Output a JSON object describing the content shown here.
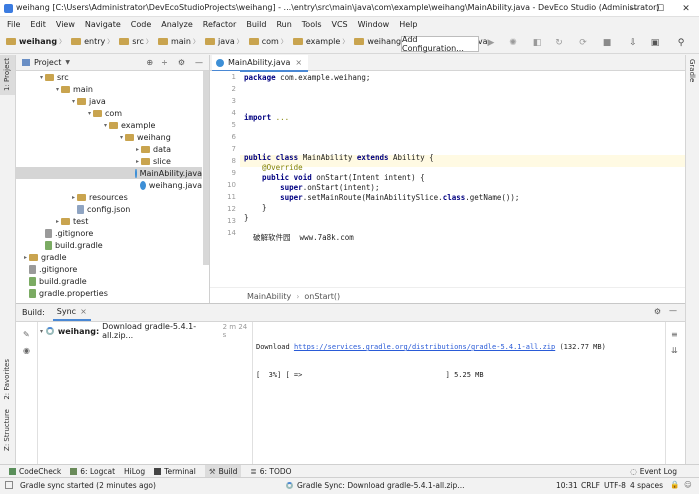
{
  "window": {
    "title": "weihang [C:\\Users\\Administrator\\DevEcoStudioProjects\\weihang] - ...\\entry\\src\\main\\java\\com\\example\\weihang\\MainAbility.java - DevEco Studio (Administrator)",
    "minimize": "—",
    "maximize": "☐",
    "close": "✕"
  },
  "menu": [
    "File",
    "Edit",
    "View",
    "Navigate",
    "Code",
    "Analyze",
    "Refactor",
    "Build",
    "Run",
    "Tools",
    "VCS",
    "Window",
    "Help"
  ],
  "breadcrumb": [
    "weihang",
    "entry",
    "src",
    "main",
    "java",
    "com",
    "example",
    "weihang",
    "MainAbility.java"
  ],
  "toolbar": {
    "config_label": "Add Configuration..."
  },
  "project_panel": {
    "title": "Project",
    "side_label": "1: Project",
    "tree": [
      {
        "label": "src",
        "arrow": "▾",
        "type": "folder"
      },
      {
        "label": "main",
        "arrow": "▾",
        "type": "folder"
      },
      {
        "label": "java",
        "arrow": "▾",
        "type": "folder"
      },
      {
        "label": "com",
        "arrow": "▾",
        "type": "folder"
      },
      {
        "label": "example",
        "arrow": "▾",
        "type": "folder"
      },
      {
        "label": "weihang",
        "arrow": "▾",
        "type": "folder"
      },
      {
        "label": "data",
        "arrow": "▸",
        "type": "folder"
      },
      {
        "label": "slice",
        "arrow": "▸",
        "type": "folder"
      },
      {
        "label": "MainAbility.java",
        "arrow": "",
        "type": "java",
        "selected": true
      },
      {
        "label": "weihang.java",
        "arrow": "",
        "type": "java"
      },
      {
        "label": "resources",
        "arrow": "▸",
        "type": "folder"
      },
      {
        "label": "config.json",
        "arrow": "",
        "type": "json"
      },
      {
        "label": "test",
        "arrow": "▸",
        "type": "folder"
      },
      {
        "label": ".gitignore",
        "arrow": "",
        "type": "file"
      },
      {
        "label": "build.gradle",
        "arrow": "",
        "type": "gradle"
      },
      {
        "label": "gradle",
        "arrow": "▸",
        "type": "folder"
      },
      {
        "label": ".gitignore",
        "arrow": "",
        "type": "file"
      },
      {
        "label": "build.gradle",
        "arrow": "",
        "type": "gradle"
      },
      {
        "label": "gradle.properties",
        "arrow": "",
        "type": "gradle"
      }
    ]
  },
  "editor": {
    "tab_label": "MainAbility.java",
    "tab_close": "×",
    "line_numbers": [
      "1",
      "2",
      "3",
      "4",
      "5",
      "6",
      "7",
      "8",
      "9",
      "10",
      "11",
      "12",
      "13",
      "14"
    ],
    "lines": [
      {
        "parts": [
          {
            "t": "package",
            "c": "kw"
          },
          {
            "t": " com.example.weihang;",
            "c": ""
          }
        ]
      },
      {
        "parts": []
      },
      {
        "parts": [
          {
            "t": "import",
            "c": "kw"
          },
          {
            "t": " ...",
            "c": "anno"
          }
        ]
      },
      {
        "parts": []
      },
      {
        "parts": [
          {
            "t": "public class",
            "c": "kw"
          },
          {
            "t": " MainAbility ",
            "c": ""
          },
          {
            "t": "extends",
            "c": "kw"
          },
          {
            "t": " Ability {",
            "c": ""
          }
        ]
      },
      {
        "parts": [
          {
            "t": "    @Override",
            "c": "anno"
          }
        ]
      },
      {
        "parts": [
          {
            "t": "    public void",
            "c": "kw"
          },
          {
            "t": " onStart(Intent intent) {",
            "c": ""
          }
        ]
      },
      {
        "parts": [
          {
            "t": "        super",
            "c": "kw"
          },
          {
            "t": ".onStart(intent);",
            "c": ""
          }
        ]
      },
      {
        "parts": [
          {
            "t": "        super",
            "c": "kw"
          },
          {
            "t": ".setMainRoute(MainAbilitySlice.",
            "c": ""
          },
          {
            "t": "class",
            "c": "kw"
          },
          {
            "t": ".getName());",
            "c": ""
          }
        ]
      },
      {
        "parts": [
          {
            "t": "    }",
            "c": ""
          }
        ]
      },
      {
        "parts": [
          {
            "t": "}",
            "c": ""
          }
        ]
      },
      {
        "parts": [
          {
            "t": "  破解软件园  www.7a8k.com",
            "c": ""
          }
        ]
      }
    ],
    "breadcrumb_class": "MainAbility",
    "breadcrumb_method": "onStart()"
  },
  "build": {
    "label": "Build:",
    "tab": "Sync",
    "tab_close": "×",
    "task_name": "weihang:",
    "task_text": "Download gradle-5.4.1-all.zip...",
    "task_time": "2 m 24 s",
    "out_prefix": "Download ",
    "out_url": "https://services.gradle.org/distributions/gradle-5.4.1-all.zip",
    "out_size": " (132.77 MB)",
    "progress_text": "[  3%] [ =>                                  ] 5.25 MB",
    "progress_pct": 3
  },
  "left_side_tabs": [
    "2: Favorites",
    "Z: Structure"
  ],
  "right_side_tabs": [
    "Gradle"
  ],
  "bottom_tools": [
    "CodeCheck",
    "6: Logcat",
    "HiLog",
    "Terminal",
    "Build",
    "6: TODO"
  ],
  "event_log": "Event Log",
  "status": {
    "left": "Gradle sync started (2 minutes ago)",
    "center": "Gradle Sync: Download gradle-5.4.1-all.zip...",
    "position": "10:31",
    "line_sep": "CRLF",
    "encoding": "UTF-8",
    "indent": "4 spaces"
  }
}
